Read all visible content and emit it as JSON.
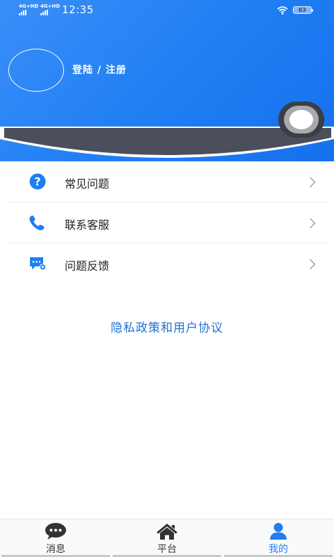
{
  "status_bar": {
    "time": "12:35",
    "signal_1": "4G+HD",
    "signal_2": "4G+HD",
    "battery": "83"
  },
  "header": {
    "login_label": "登陆 / 注册"
  },
  "menu": {
    "items": [
      {
        "label": "常见问题",
        "icon": "question-icon"
      },
      {
        "label": "联系客服",
        "icon": "phone-icon"
      },
      {
        "label": "问题反馈",
        "icon": "feedback-icon"
      }
    ]
  },
  "privacy_link": "隐私政策和用户协议",
  "tabbar": {
    "items": [
      {
        "label": "消息",
        "icon": "chat-icon"
      },
      {
        "label": "平台",
        "icon": "home-icon"
      },
      {
        "label": "我的",
        "icon": "user-icon"
      }
    ],
    "active_index": 2
  },
  "colors": {
    "accent": "#1f7ef3",
    "link": "#1f6fd6"
  }
}
